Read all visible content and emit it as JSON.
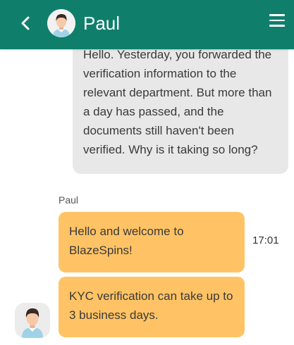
{
  "header": {
    "title": "Paul",
    "back_icon": "chevron-left-icon",
    "menu_icon": "hamburger-menu-icon",
    "background_color": "#0f7f6c"
  },
  "messages": {
    "outgoing": {
      "text": "Hello. Yesterday, you forwarded the verification information to the relevant department. But more than a day has passed, and the documents still haven't been verified. Why is it taking so long?"
    },
    "incoming_group": {
      "sender": "Paul",
      "time": "17:01",
      "bubbles": [
        {
          "text": "Hello and welcome to BlazeSpins!"
        },
        {
          "text": "KYC verification can take up to 3 business days."
        }
      ],
      "bubble_color": "#ffc365"
    }
  }
}
